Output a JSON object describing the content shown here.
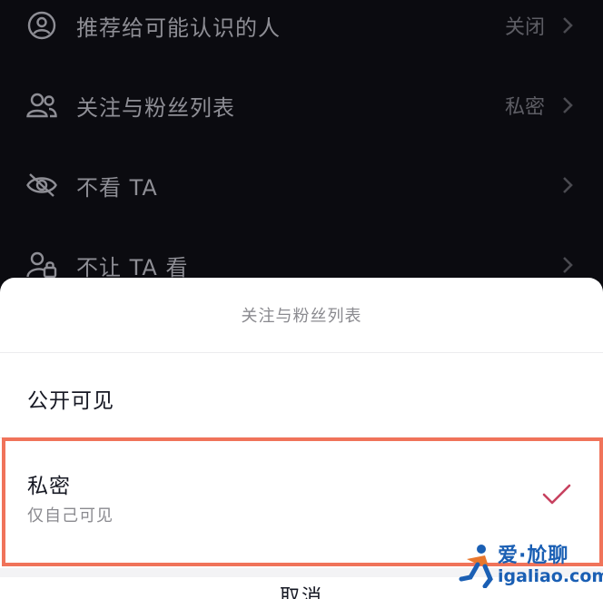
{
  "settings": {
    "items": [
      {
        "label": "推荐给可能认识的人",
        "value": "关闭",
        "icon": "person-circle-icon"
      },
      {
        "label": "关注与粉丝列表",
        "value": "私密",
        "icon": "users-icon"
      },
      {
        "label": "不看 TA",
        "value": "",
        "icon": "eye-off-icon"
      },
      {
        "label": "不让 TA 看",
        "value": "",
        "icon": "person-lock-icon"
      }
    ]
  },
  "sheet": {
    "title": "关注与粉丝列表",
    "options": [
      {
        "label": "公开可见",
        "sub": "",
        "selected": false
      },
      {
        "label": "私密",
        "sub": "仅自己可见",
        "selected": true
      }
    ],
    "cancel_label": "取消"
  },
  "watermark": {
    "top": "爱·尬聊",
    "bottom": "igaliao.com"
  },
  "colors": {
    "check": "#c7415f",
    "highlight": "#f0735a",
    "watermark": "#1a5fb4"
  }
}
